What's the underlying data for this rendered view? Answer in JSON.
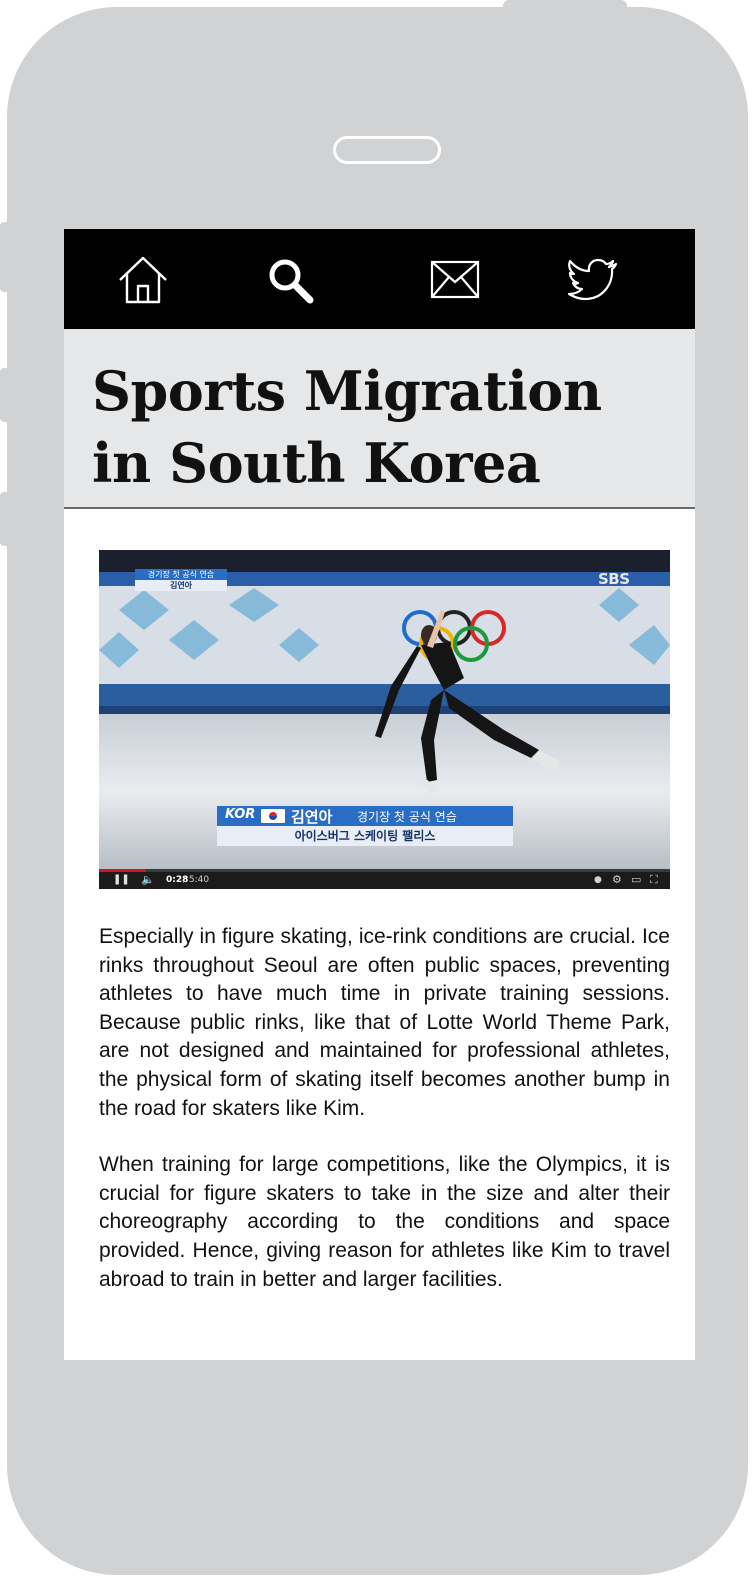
{
  "nav": {
    "items": [
      {
        "name": "home",
        "icon": "home-icon"
      },
      {
        "name": "search",
        "icon": "search-icon"
      },
      {
        "name": "mail",
        "icon": "mail-icon"
      },
      {
        "name": "twitter",
        "icon": "twitter-icon"
      }
    ]
  },
  "page": {
    "title": "Sports Migration in South Korea"
  },
  "video": {
    "top_tag_line1": "경기장 첫 공식 연습",
    "top_tag_line2": "김연아",
    "broadcaster": "SBS",
    "lower_third": {
      "country": "KOR",
      "name": "김연아",
      "description": "경기장 첫 공식 연습",
      "venue": "아이스버그 스케이팅 팰리스"
    },
    "time_current": "0:28",
    "time_total": "/ 5:40",
    "progress_fraction": 0.082
  },
  "article": {
    "paragraphs": [
      "Especially in figure skating, ice-rink conditions are crucial. Ice rinks throughout Seoul are often public spaces, preventing athletes to have much time in private training sessions. Because public rinks, like that of Lotte World Theme Park, are not designed and maintained for professional athletes, the physical form of skating itself becomes another bump in the road for skaters like Kim.",
      "When training for large competitions, like the Olympics, it is crucial for figure skaters to take in the size and alter their choreography according to the conditions and space provided. Hence, giving reason for athletes like Kim to travel abroad to train in better and larger facilities."
    ]
  },
  "colors": {
    "frame": "#d1d2d4",
    "navbar": "#000000",
    "title_bar": "#e6e7e8",
    "broadcast_blue": "#2a6dc4"
  }
}
